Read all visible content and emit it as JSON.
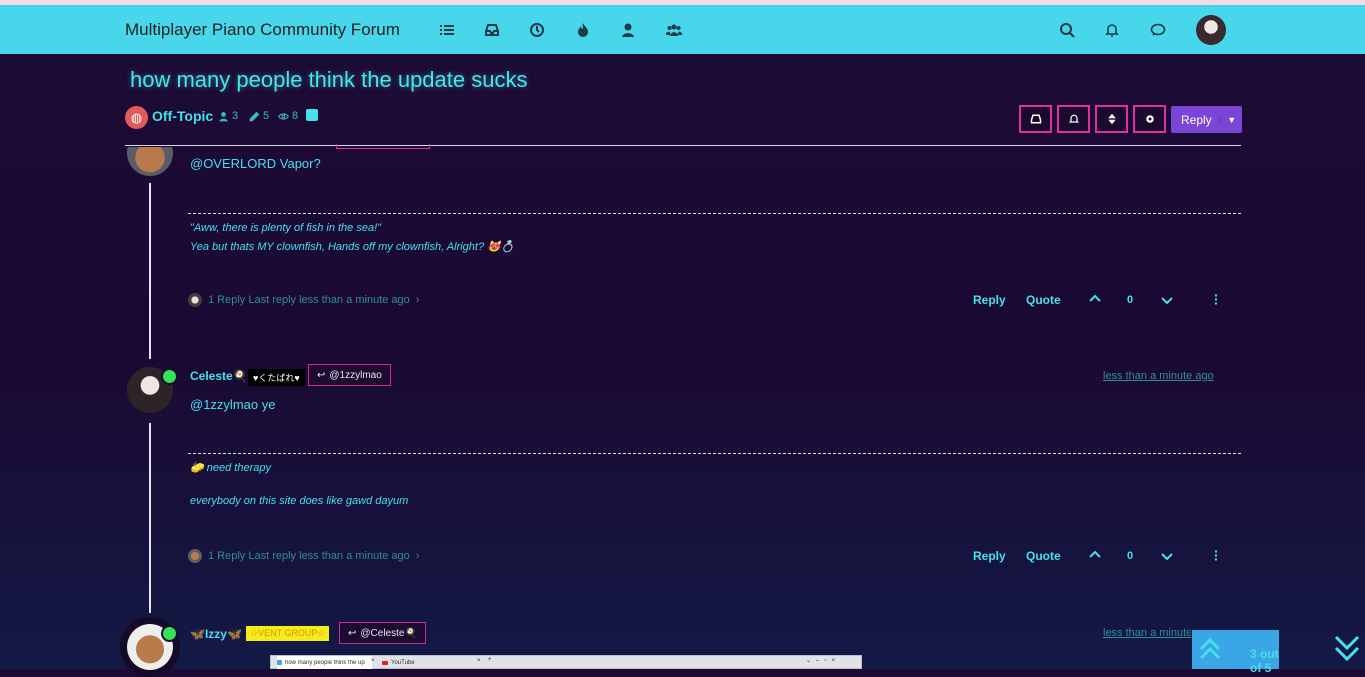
{
  "navbar": {
    "brand": "Multiplayer Piano Community Forum",
    "icons": [
      "list-icon",
      "inbox-icon",
      "clock-icon",
      "fire-icon",
      "user-icon",
      "users-icon",
      "search-icon",
      "bell-icon",
      "chat-icon"
    ]
  },
  "topic": {
    "title": "how many people think the update sucks",
    "category": "Off-Topic",
    "posters": "3",
    "posts": "5",
    "views": "8"
  },
  "toolbar": {
    "reply_label": "Reply"
  },
  "posts": [
    {
      "content": "@OVERLORD Vapor?",
      "signature": [
        "\"Aww, there is plenty of fish in the sea!\"",
        "Yea but thats MY clownfish, Hands off my clownfish, Alright? 😻💍"
      ],
      "replies": "1 Reply Last reply less than a minute ago",
      "reply_label": "Reply",
      "quote_label": "Quote",
      "votes": "0"
    },
    {
      "author": "Celeste🍳",
      "badge": "♥くたばれ♥",
      "reply_to": "@1zzylmao",
      "timestamp": "less than a minute ago",
      "content": "@1zzylmao ye",
      "signature": [
        "🧽 need therapy",
        "everybody on this site does like gawd dayum"
      ],
      "replies": "1 Reply Last reply less than a minute ago",
      "reply_label": "Reply",
      "quote_label": "Quote",
      "votes": "0"
    },
    {
      "author": "🦋Izzy🦋",
      "badge": "☆VENT GROUP☆",
      "reply_to": "@Celeste🍳",
      "timestamp": "less than a minute ago"
    }
  ],
  "pagination": {
    "position": "3 out of 5"
  },
  "taskbar": {
    "tab1": "how many people think the upd",
    "tab2": "YouTube"
  },
  "colors": {
    "navbar": "#48d6ea",
    "accent": "#46e0ea",
    "button_border": "#e0309f",
    "reply_button": "#7b45d6"
  }
}
